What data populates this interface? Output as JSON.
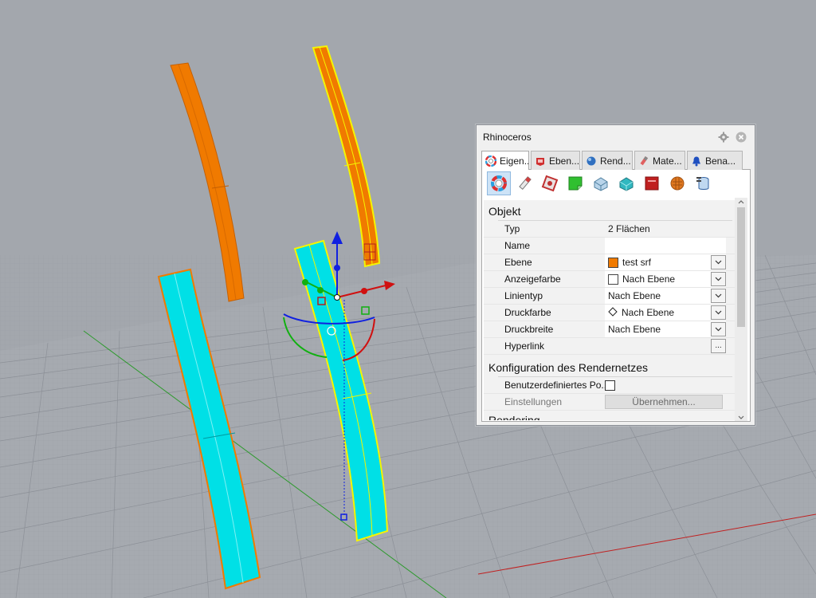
{
  "panel": {
    "title": "Rhinoceros",
    "tabs": [
      {
        "label": "Eigen...",
        "icon": "color-wheel-icon"
      },
      {
        "label": "Eben...",
        "icon": "layers-icon"
      },
      {
        "label": "Rend...",
        "icon": "render-sphere-icon"
      },
      {
        "label": "Mate...",
        "icon": "material-brush-icon"
      },
      {
        "label": "Bena...",
        "icon": "bell-icon"
      }
    ],
    "toolbar_icons": [
      "object-properties-icon",
      "pencil-icon",
      "texture-map-icon",
      "decal-icon",
      "displacement-icon",
      "shell-icon",
      "curve-piping-icon",
      "edge-softening-icon",
      "database-icon"
    ],
    "sections": {
      "object": {
        "title": "Objekt",
        "rows": [
          {
            "label": "Typ",
            "value": "2 Flächen"
          },
          {
            "label": "Name",
            "value": ""
          },
          {
            "label": "Ebene",
            "value": "test srf",
            "swatch": "#f07a00"
          },
          {
            "label": "Anzeigefarbe",
            "value": "Nach Ebene",
            "swatch": "#ffffff"
          },
          {
            "label": "Linientyp",
            "value": "Nach Ebene"
          },
          {
            "label": "Druckfarbe",
            "value": "Nach Ebene"
          },
          {
            "label": "Druckbreite",
            "value": "Nach Ebene"
          },
          {
            "label": "Hyperlink",
            "value": "",
            "button": "..."
          }
        ]
      },
      "mesh": {
        "title": "Konfiguration des Rendernetzes",
        "custom_label": "Benutzerdefiniertes Po...",
        "settings_label": "Einstellungen",
        "apply_button": "Übernehmen..."
      },
      "rendering": {
        "title": "Rendering"
      }
    }
  },
  "colors": {
    "viewport_bg": "#a3a7ad",
    "grid": "#8e9299",
    "orange_surface": "#f07a00",
    "cyan_surface": "#00e0e6",
    "selection_yellow": "#f5f500",
    "axis_x": "#d01010",
    "axis_y": "#10b010",
    "axis_z": "#1020e0"
  }
}
